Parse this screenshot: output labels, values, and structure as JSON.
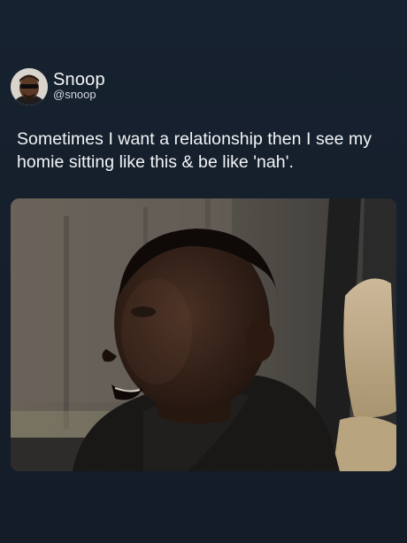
{
  "author": {
    "display_name": "Snoop",
    "handle": "@snoop",
    "avatar_icon": "profile-avatar"
  },
  "tweet": {
    "text": "Sometimes I want a relationship then I see my homie sitting like this & be like 'nah'."
  },
  "media": {
    "kind": "photo",
    "subject": "man-in-car"
  },
  "colors": {
    "background": "#16202c",
    "text": "#f2f4f6",
    "handle": "#cfd6dd"
  }
}
